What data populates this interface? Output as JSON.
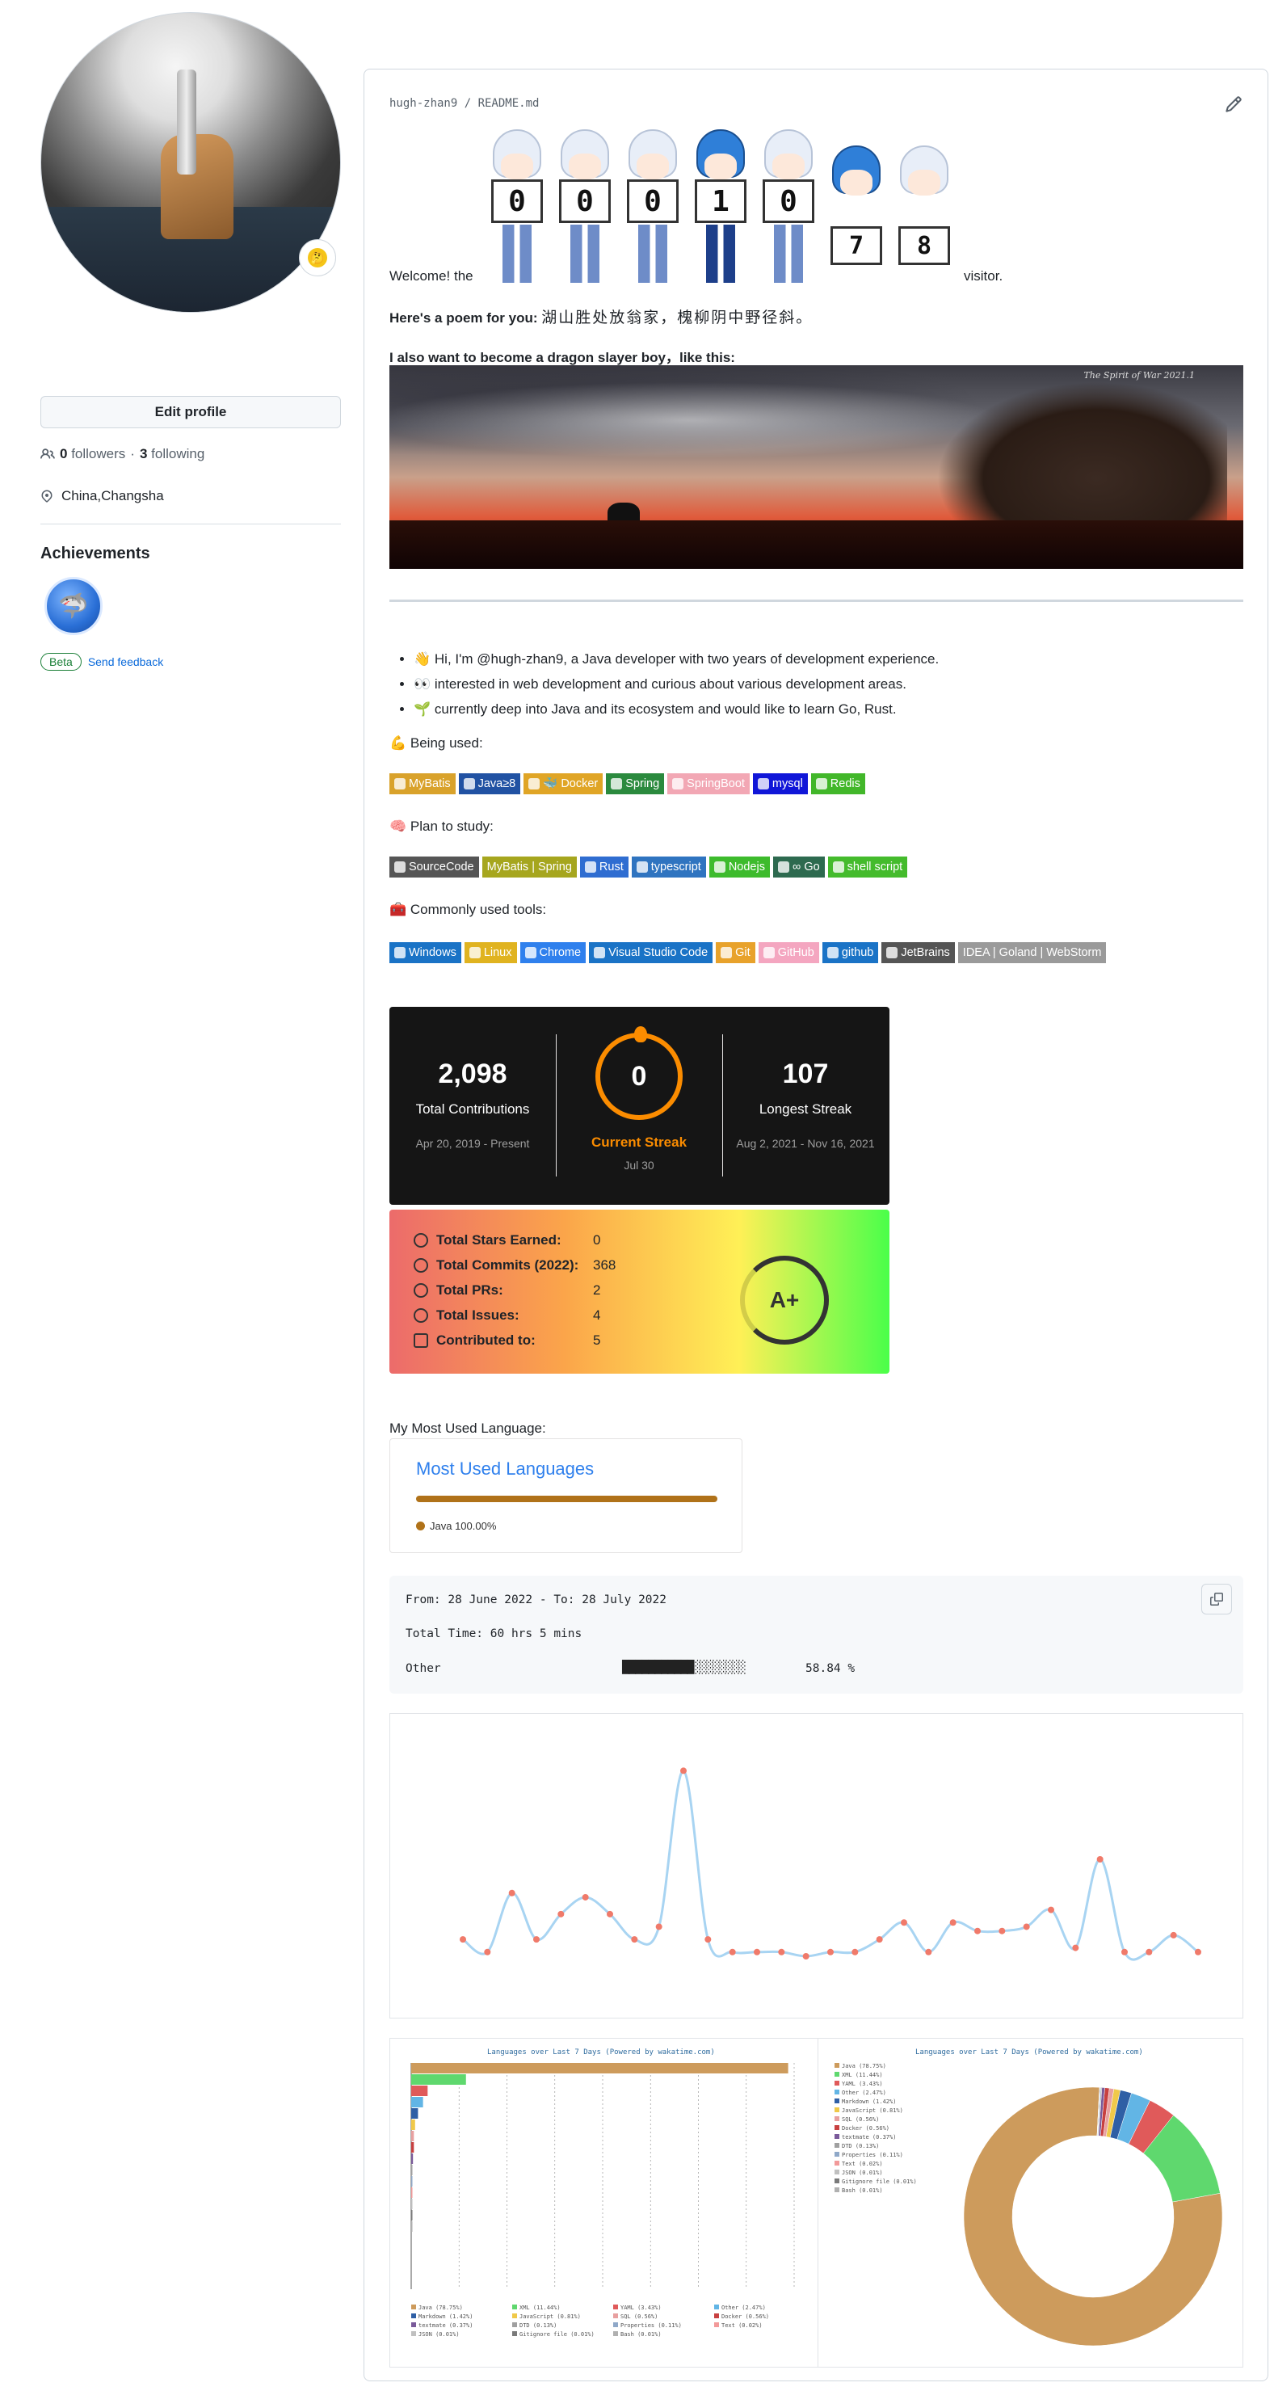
{
  "profile": {
    "status_emoji": "🤔",
    "edit_label": "Edit profile",
    "followers_count": "0",
    "followers_label": "followers",
    "following_count": "3",
    "following_label": "following",
    "separator": "·",
    "location": "China,Changsha",
    "achievements_title": "Achievements",
    "beta_label": "Beta",
    "feedback_label": "Send feedback"
  },
  "readme": {
    "path": "hugh-zhan9 / README.md",
    "welcome_pre": "Welcome! the",
    "welcome_post": "visitor.",
    "counter_digits": [
      "0",
      "0",
      "0",
      "1",
      "0",
      "7",
      "8"
    ],
    "poem_label": "Here's a poem for you:",
    "poem": "湖山胜处放翁家，槐柳阴中野径斜。",
    "dragon_line": "I also want to become a dragon slayer boy，like this:",
    "banner_signature": "The Spirit of War 2021.1",
    "bullets": [
      "👋 Hi, I'm @hugh-zhan9, a Java developer with two years of development experience.",
      "👀 interested in web development and curious about various development areas.",
      "🌱 currently deep into Java and its ecosystem and would like to learn Go, Rust."
    ],
    "being_used": "💪 Being used:",
    "plan": "🧠 Plan to study:",
    "tools": "🧰 Commonly used tools:"
  },
  "badges_used": [
    {
      "label": "MyBatis",
      "color": "#d9a22b"
    },
    {
      "label": "Java≥8",
      "color": "#2152a3"
    },
    {
      "label": "🐳 Docker",
      "color": "#e0a526"
    },
    {
      "label": "Spring",
      "color": "#2b8a3e"
    },
    {
      "label": "SpringBoot",
      "color": "#f2a7b4"
    },
    {
      "label": "mysql",
      "color": "#1016d8"
    },
    {
      "label": "Redis",
      "color": "#42b72a"
    }
  ],
  "badges_plan": [
    {
      "label": "SourceCode",
      "color": "#555555"
    },
    {
      "label": "MyBatis | Spring",
      "color": "#a6a61e"
    },
    {
      "label": "Rust",
      "color": "#2f6dd1"
    },
    {
      "label": "typescript",
      "color": "#2f74c0"
    },
    {
      "label": "Nodejs",
      "color": "#3dbb2c"
    },
    {
      "label": "∞ Go",
      "color": "#2d6a4f"
    },
    {
      "label": "shell script",
      "color": "#44bb2c"
    }
  ],
  "badges_tools": [
    {
      "label": "Windows",
      "color": "#1a73c6"
    },
    {
      "label": "Linux",
      "color": "#e0b320"
    },
    {
      "label": "Chrome",
      "color": "#2f80ed"
    },
    {
      "label": "Visual Studio Code",
      "color": "#1a73c6"
    },
    {
      "label": "Git",
      "color": "#e8a22b"
    },
    {
      "label": "GitHub",
      "color": "#f4a6c0"
    },
    {
      "label": "github",
      "color": "#1a73c6"
    },
    {
      "label": "JetBrains",
      "color": "#555555"
    },
    {
      "label": "IDEA | Goland | WebStorm",
      "color": "#9a9a9a"
    }
  ],
  "streak": {
    "total_value": "2,098",
    "total_label": "Total Contributions",
    "total_range": "Apr 20, 2019 - Present",
    "current_value": "0",
    "current_label": "Current Streak",
    "current_date": "Jul 30",
    "longest_value": "107",
    "longest_label": "Longest Streak",
    "longest_range": "Aug 2, 2021 - Nov 16, 2021",
    "accent": "#fb8c00"
  },
  "stats": {
    "rows": [
      {
        "label": "Total Stars Earned:",
        "value": "0"
      },
      {
        "label": "Total Commits (2022):",
        "value": "368"
      },
      {
        "label": "Total PRs:",
        "value": "2"
      },
      {
        "label": "Total Issues:",
        "value": "4"
      },
      {
        "label": "Contributed to:",
        "value": "5"
      }
    ],
    "grade": "A+"
  },
  "languages": {
    "heading": "My Most Used Language:",
    "title": "Most Used Languages",
    "item": "Java 100.00%",
    "color": "#b07219"
  },
  "wakatime_text": {
    "range": "From: 28 June 2022 - To: 28 July 2022",
    "total": "Total Time: 60 hrs 5 mins",
    "other_label": "Other",
    "other_bar": "███████████░░░░░░░░",
    "other_pct": "58.84 %"
  },
  "chart_data": [
    {
      "type": "line",
      "title": "",
      "x": [
        1,
        2,
        3,
        4,
        5,
        6,
        7,
        8,
        9,
        10,
        11,
        12,
        13,
        14,
        15,
        16,
        17,
        18,
        19,
        20,
        21,
        22,
        23,
        24,
        25,
        26,
        27,
        28,
        29,
        30,
        31
      ],
      "y": [
        0.4,
        0.1,
        1.5,
        0.4,
        1.0,
        1.4,
        1.0,
        0.4,
        0.7,
        4.4,
        0.4,
        0.1,
        0.1,
        0.1,
        0.0,
        0.1,
        0.1,
        0.4,
        0.8,
        0.1,
        0.8,
        0.6,
        0.6,
        0.7,
        1.1,
        0.2,
        2.3,
        0.1,
        0.1,
        0.5,
        0.1
      ],
      "line_color": "#a8d4f2",
      "point_color": "#f07a6a"
    },
    {
      "type": "bar",
      "title": "Languages over Last 7 Days (Powered by wakatime.com)",
      "categories": [
        "Java",
        "XML",
        "YAML",
        "Other",
        "Markdown",
        "JavaScript",
        "SQL",
        "Docker",
        "textmate",
        "DTD",
        "Properties",
        "Text",
        "JSON",
        "Gitignore file",
        "Bash"
      ],
      "values": [
        78.75,
        11.44,
        3.43,
        2.47,
        1.42,
        0.81,
        0.56,
        0.56,
        0.37,
        0.13,
        0.11,
        0.02,
        0.01,
        0.01,
        0.01
      ],
      "colors": [
        "#cd9b5c",
        "#5fd86e",
        "#e05a5a",
        "#62b5e5",
        "#2f5fa5",
        "#f0c94a",
        "#e8a0a0",
        "#c84040",
        "#7a5a9a",
        "#a0a0a0",
        "#8fa8c8",
        "#f29a9a",
        "#c0c0c0",
        "#7a7a7a",
        "#b0b0b0"
      ],
      "legend": [
        "Java (78.75%)",
        "XML (11.44%)",
        "YAML (3.43%)",
        "Other (2.47%)",
        "Markdown (1.42%)",
        "JavaScript (0.81%)",
        "SQL (0.56%)",
        "Docker (0.56%)",
        "textmate (0.37%)",
        "DTD (0.13%)",
        "Properties (0.11%)",
        "Text (0.02%)",
        "JSON (0.01%)",
        "Gitignore file (0.01%)",
        "Bash (0.01%)"
      ]
    },
    {
      "type": "pie",
      "title": "Languages over Last 7 Days (Powered by wakatime.com)",
      "categories": [
        "Java",
        "XML",
        "YAML",
        "Other",
        "Markdown",
        "JavaScript",
        "SQL",
        "Docker",
        "textmate",
        "DTD",
        "Properties",
        "Text",
        "JSON",
        "Gitignore file",
        "Bash"
      ],
      "values": [
        78.75,
        11.44,
        3.43,
        2.47,
        1.42,
        0.81,
        0.56,
        0.56,
        0.37,
        0.13,
        0.11,
        0.02,
        0.01,
        0.01,
        0.01
      ],
      "colors": [
        "#cd9b5c",
        "#5fd86e",
        "#e05a5a",
        "#62b5e5",
        "#2f5fa5",
        "#f0c94a",
        "#e8a0a0",
        "#c84040",
        "#7a5a9a",
        "#a0a0a0",
        "#8fa8c8",
        "#f29a9a",
        "#c0c0c0",
        "#7a7a7a",
        "#b0b0b0"
      ],
      "legend": [
        "Java (78.75%)",
        "XML (11.44%)",
        "YAML (3.43%)",
        "Other (2.47%)",
        "Markdown (1.42%)",
        "JavaScript (0.81%)",
        "SQL (0.56%)",
        "Docker (0.56%)",
        "textmate (0.37%)",
        "DTD (0.13%)",
        "Properties (0.11%)",
        "Text (0.02%)",
        "JSON (0.01%)",
        "Gitignore file (0.01%)",
        "Bash (0.01%)"
      ]
    }
  ]
}
